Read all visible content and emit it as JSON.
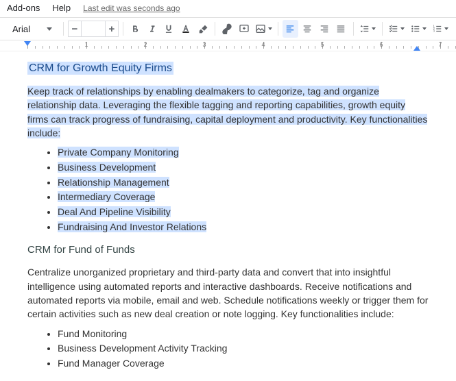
{
  "menubar": {
    "addons": "Add-ons",
    "help": "Help",
    "last_edit": "Last edit was seconds ago"
  },
  "toolbar": {
    "font_name": "Arial",
    "font_size": ""
  },
  "document": {
    "section1": {
      "heading": "CRM for Growth Equity Firms",
      "paragraph": "Keep track of relationships by enabling dealmakers to categorize, tag and organize relationship data. Leveraging the flexible tagging and reporting capabilities, growth equity firms can track progress of fundraising, capital deployment and productivity. Key functionalities include:",
      "bullets": [
        "Private Company Monitoring",
        "Business Development",
        "Relationship Management",
        "Intermediary Coverage",
        "Deal And Pipeline Visibility",
        "Fundraising And Investor Relations"
      ]
    },
    "section2": {
      "heading": "CRM for Fund of Funds",
      "paragraph": "Centralize unorganized proprietary and third-party data and convert that into insightful intelligence using automated reports and interactive dashboards. Receive notifications and automated reports via mobile, email and web. Schedule notifications weekly or trigger them for certain activities such as new deal creation or note logging. Key functionalities include:",
      "bullets": [
        "Fund Monitoring",
        "Business Development Activity Tracking",
        "Fund Manager Coverage"
      ]
    }
  }
}
